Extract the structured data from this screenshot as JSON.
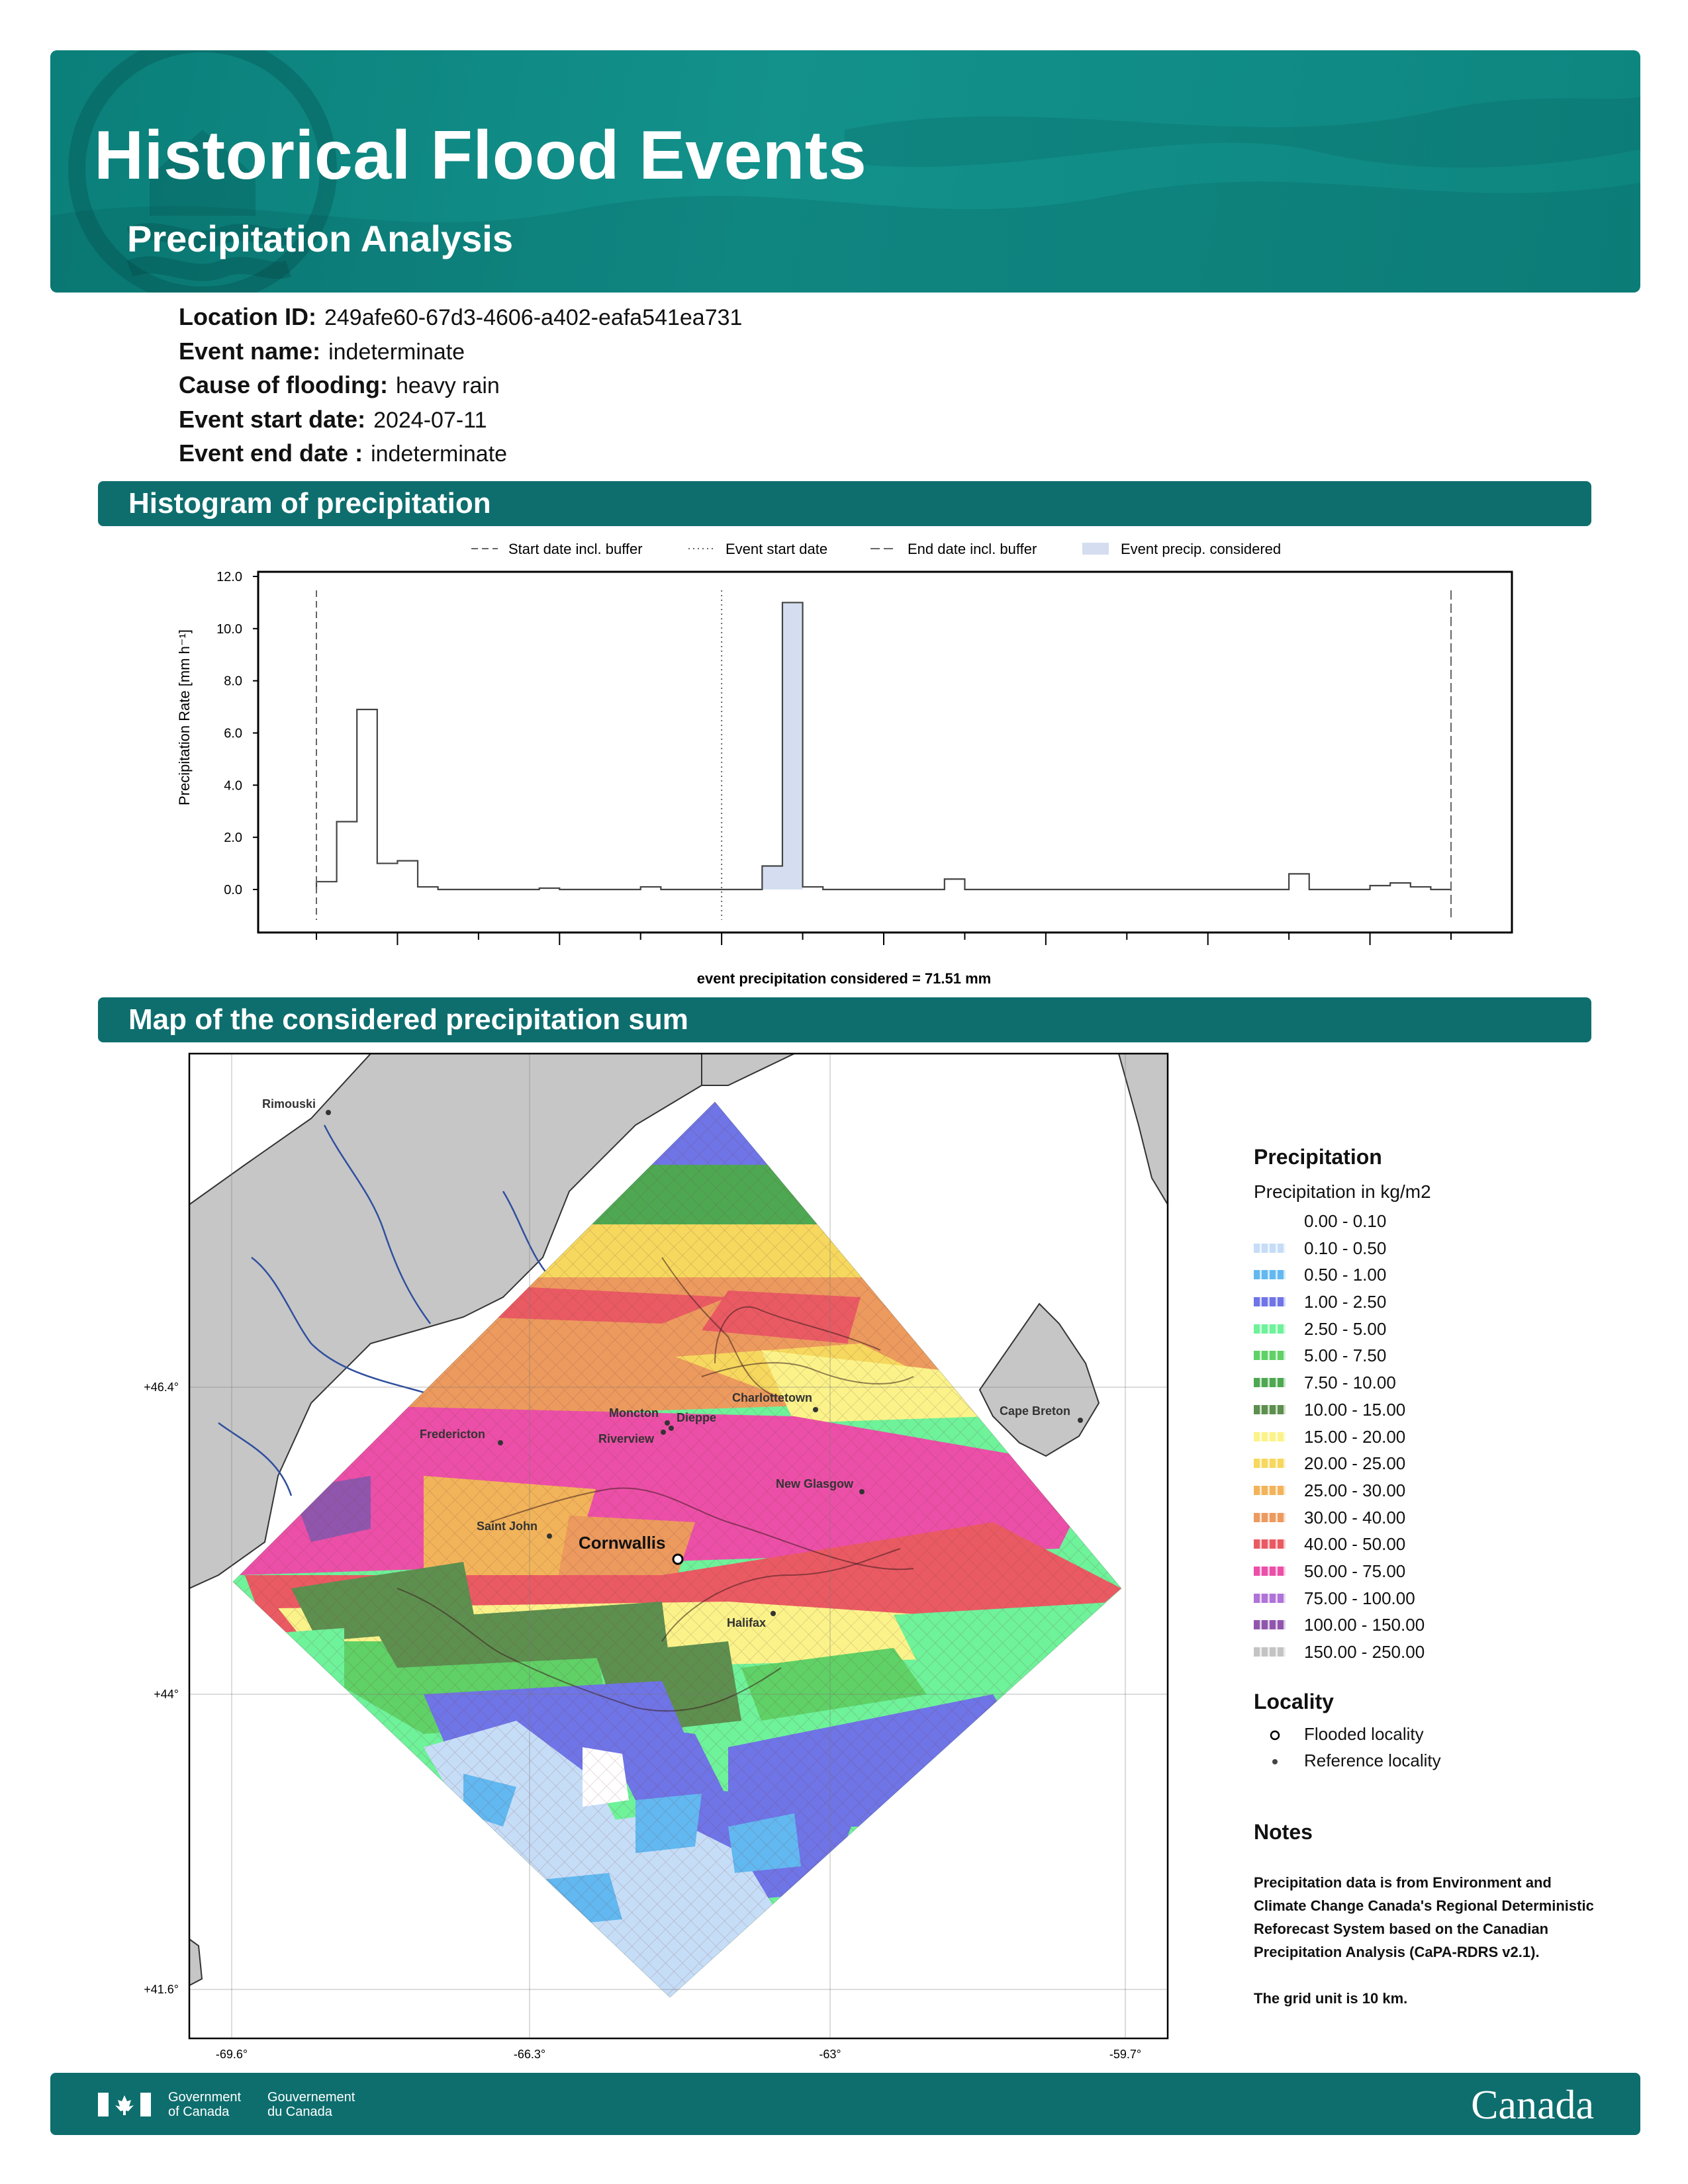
{
  "header": {
    "title": "Historical Flood Events",
    "subtitle": "Precipitation Analysis"
  },
  "event_info": [
    {
      "key": "Location ID:",
      "value": "249afe60-67d3-4606-a402-eafa541ea731"
    },
    {
      "key": "Event name:",
      "value": "indeterminate"
    },
    {
      "key": "Cause of flooding:",
      "value": "heavy rain"
    },
    {
      "key": "Event start date:",
      "value": "2024-07-11"
    },
    {
      "key": "Event end date :",
      "value": "indeterminate"
    }
  ],
  "sections": {
    "histogram": "Histogram of precipitation",
    "map": "Map of the considered precipitation sum"
  },
  "chart_data": {
    "type": "bar",
    "title": "",
    "xlabel": "",
    "ylabel": "Precipitation Rate [mm h⁻¹]",
    "ylim": [
      0,
      12
    ],
    "yticks": [
      "0.0",
      "2.0",
      "4.0",
      "6.0",
      "8.0",
      "10.0",
      "12.0"
    ],
    "xlim": [
      0,
      58
    ],
    "legend": [
      "Start date incl. buffer",
      "Event start date",
      "End date incl. buffer",
      "Event precip. considered"
    ],
    "legend_position": "top",
    "markers": {
      "start_buffer": 0,
      "event_start": 20,
      "end_buffer": 56
    },
    "highlight_bins": [
      22,
      23
    ],
    "values": [
      0.3,
      2.6,
      6.9,
      1.0,
      1.1,
      0.1,
      0.0,
      0.0,
      0.0,
      0.0,
      0.0,
      0.05,
      0.0,
      0.0,
      0.0,
      0.0,
      0.1,
      0.0,
      0.0,
      0.0,
      0.0,
      0.0,
      0.9,
      11.0,
      0.1,
      0.0,
      0.0,
      0.0,
      0.0,
      0.0,
      0.0,
      0.4,
      0.0,
      0.0,
      0.0,
      0.0,
      0.0,
      0.0,
      0.0,
      0.0,
      0.0,
      0.0,
      0.0,
      0.0,
      0.0,
      0.0,
      0.0,
      0.0,
      0.6,
      0.0,
      0.0,
      0.0,
      0.15,
      0.25,
      0.1,
      0.0
    ],
    "annotation": "event precipitation considered = 71.51 mm"
  },
  "map": {
    "lat_labels": [
      "+46.4°",
      "+44°",
      "+41.6°"
    ],
    "lon_labels": [
      "-69.6°",
      "-66.3°",
      "-63°",
      "-59.7°"
    ],
    "reference_localities": [
      "Rimouski",
      "Fredericton",
      "Moncton",
      "Dieppe",
      "Riverview",
      "Charlottetown",
      "Cape Breton",
      "New Glasgow",
      "Saint John",
      "Halifax"
    ],
    "flooded_locality": "Cornwallis"
  },
  "legend": {
    "title": "Precipitation",
    "subtitle": "Precipitation in kg/m2",
    "classes": [
      {
        "label": "0.00 - 0.10",
        "color": "#ffffff"
      },
      {
        "label": "0.10 - 0.50",
        "color": "#c6ddf7"
      },
      {
        "label": "0.50 - 1.00",
        "color": "#62b8f0"
      },
      {
        "label": "1.00 - 2.50",
        "color": "#6f74e6"
      },
      {
        "label": "2.50 - 5.00",
        "color": "#6ef29a"
      },
      {
        "label": "5.00 - 7.50",
        "color": "#5fd166"
      },
      {
        "label": "7.50 - 10.00",
        "color": "#4ea852"
      },
      {
        "label": "10.00 - 15.00",
        "color": "#5d8f4f"
      },
      {
        "label": "15.00 - 20.00",
        "color": "#fbf38a"
      },
      {
        "label": "20.00 - 25.00",
        "color": "#f6d85e"
      },
      {
        "label": "25.00 - 30.00",
        "color": "#f2b45a"
      },
      {
        "label": "30.00 - 40.00",
        "color": "#ec9a5e"
      },
      {
        "label": "40.00 - 50.00",
        "color": "#ea5a63"
      },
      {
        "label": "50.00 - 75.00",
        "color": "#ec4fa8"
      },
      {
        "label": "75.00 - 100.00",
        "color": "#b073d8"
      },
      {
        "label": "100.00 - 150.00",
        "color": "#9056ad"
      },
      {
        "label": "150.00 - 250.00",
        "color": "#c4c4c4"
      }
    ],
    "locality_title": "Locality",
    "flooded_label": "Flooded locality",
    "reference_label": "Reference locality"
  },
  "notes": {
    "title": "Notes",
    "text": "Precipitation data is from Environment and Climate Change Canada's Regional Deterministic Reforecast System based on the Canadian Precipitation Analysis (CaPA-RDRS v2.1).",
    "grid": "The grid unit is 10 km."
  },
  "footer": {
    "gov_en": "Government of Canada",
    "gov_fr": "Gouvernement du Canada",
    "wordmark": "Canada"
  },
  "colors": {
    "banner": "#0e8a84",
    "section_bar": "#0e6e6e",
    "event_fill": "#d4def0"
  }
}
